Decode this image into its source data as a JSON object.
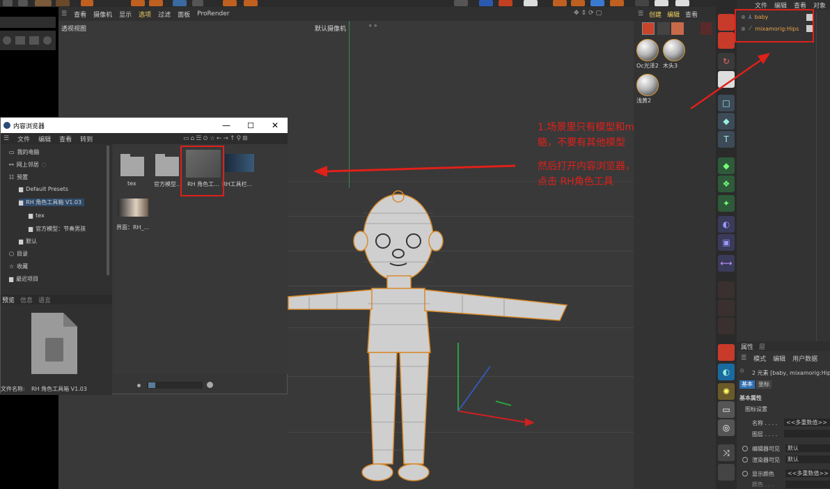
{
  "viewport": {
    "menu": [
      "查看",
      "摄像机",
      "显示",
      "选项",
      "过滤",
      "面板",
      "ProRender"
    ],
    "title": "透视视图",
    "camera": "默认摄像机"
  },
  "materials": {
    "menu": [
      "创建",
      "编辑",
      "查看"
    ],
    "items": [
      {
        "label": "Oc光泽2"
      },
      {
        "label": "木头3"
      },
      {
        "label": "浅黄2"
      }
    ]
  },
  "object_manager": {
    "menu": [
      "文件",
      "编辑",
      "查看",
      "对象"
    ],
    "objects": [
      {
        "name": "baby"
      },
      {
        "name": "mixamorig:Hips"
      }
    ]
  },
  "attributes": {
    "tabs": [
      "属性",
      "层"
    ],
    "menu": [
      "模式",
      "编辑",
      "用户数据"
    ],
    "summary": "2 元素 [baby, mixamorig:Hips",
    "sub_tabs": [
      "基本",
      "坐标"
    ],
    "section": "基本属性",
    "group": "图标设置",
    "fields": [
      {
        "label": "名称 . . . .",
        "value": "<<多重数值>>"
      },
      {
        "label": "图层 . . . .",
        "value": ""
      },
      {
        "label": "编辑器可见",
        "value": "默认"
      },
      {
        "label": "渲染器可见",
        "value": "默认"
      },
      {
        "label": "显示颜色",
        "value": "<<多重数值>>"
      },
      {
        "label": "颜色 . . .",
        "value": ""
      }
    ]
  },
  "content_browser": {
    "title": "内容浏览器",
    "menu": [
      "文件",
      "编辑",
      "查看",
      "转到"
    ],
    "tree": [
      {
        "label": "我的电脑"
      },
      {
        "label": "网上邻居"
      },
      {
        "label": "预置"
      },
      {
        "label": "Default Presets"
      },
      {
        "label": "RH 角色工具箱 V1.03"
      },
      {
        "label": "tex"
      },
      {
        "label": "官方模型：节奏男孩"
      },
      {
        "label": "默认"
      },
      {
        "label": "目录"
      },
      {
        "label": "收藏"
      },
      {
        "label": "最近项目"
      }
    ],
    "preview_tabs": [
      "预览",
      "信息",
      "语言"
    ],
    "file_name_label": "文件名称:",
    "file_name": "RH 角色工具箱 V1.03",
    "items": [
      {
        "label": "tex"
      },
      {
        "label": "官方模型..."
      },
      {
        "label": "RH 角色工..."
      },
      {
        "label": "RH工具栏..."
      },
      {
        "label": "界面：RH_..."
      }
    ]
  },
  "annotations": {
    "note1_line1": "1.场景里只有模型和mixamox骨",
    "note1_line2": "骼，不要有其他模型",
    "note2_line1": "然后打开内容浏览器，",
    "note2_line2": "点击 RH角色工具"
  },
  "colors": {
    "annotation": "#e1201a",
    "selection": "#e8a24a",
    "accent": "#2f6fb0"
  }
}
